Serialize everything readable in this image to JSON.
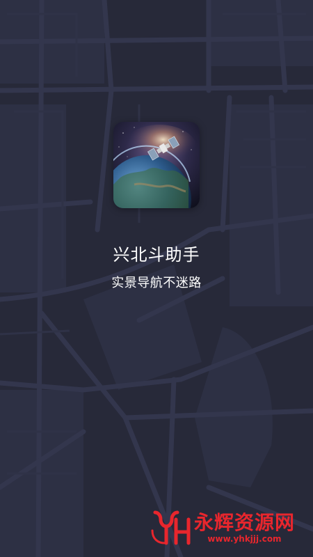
{
  "splash": {
    "app_name": "兴北斗助手",
    "slogan": "实景导航不迷路",
    "app_icon": "earth-satellite-icon"
  },
  "watermark": {
    "name": "永辉资源网",
    "url": "www.yhkjjj.com",
    "logo_icon": "yh-logo-icon"
  },
  "colors": {
    "background": "#272939",
    "map_roads": "#30334a",
    "text": "#ffffff",
    "watermark": "#e8262d"
  }
}
